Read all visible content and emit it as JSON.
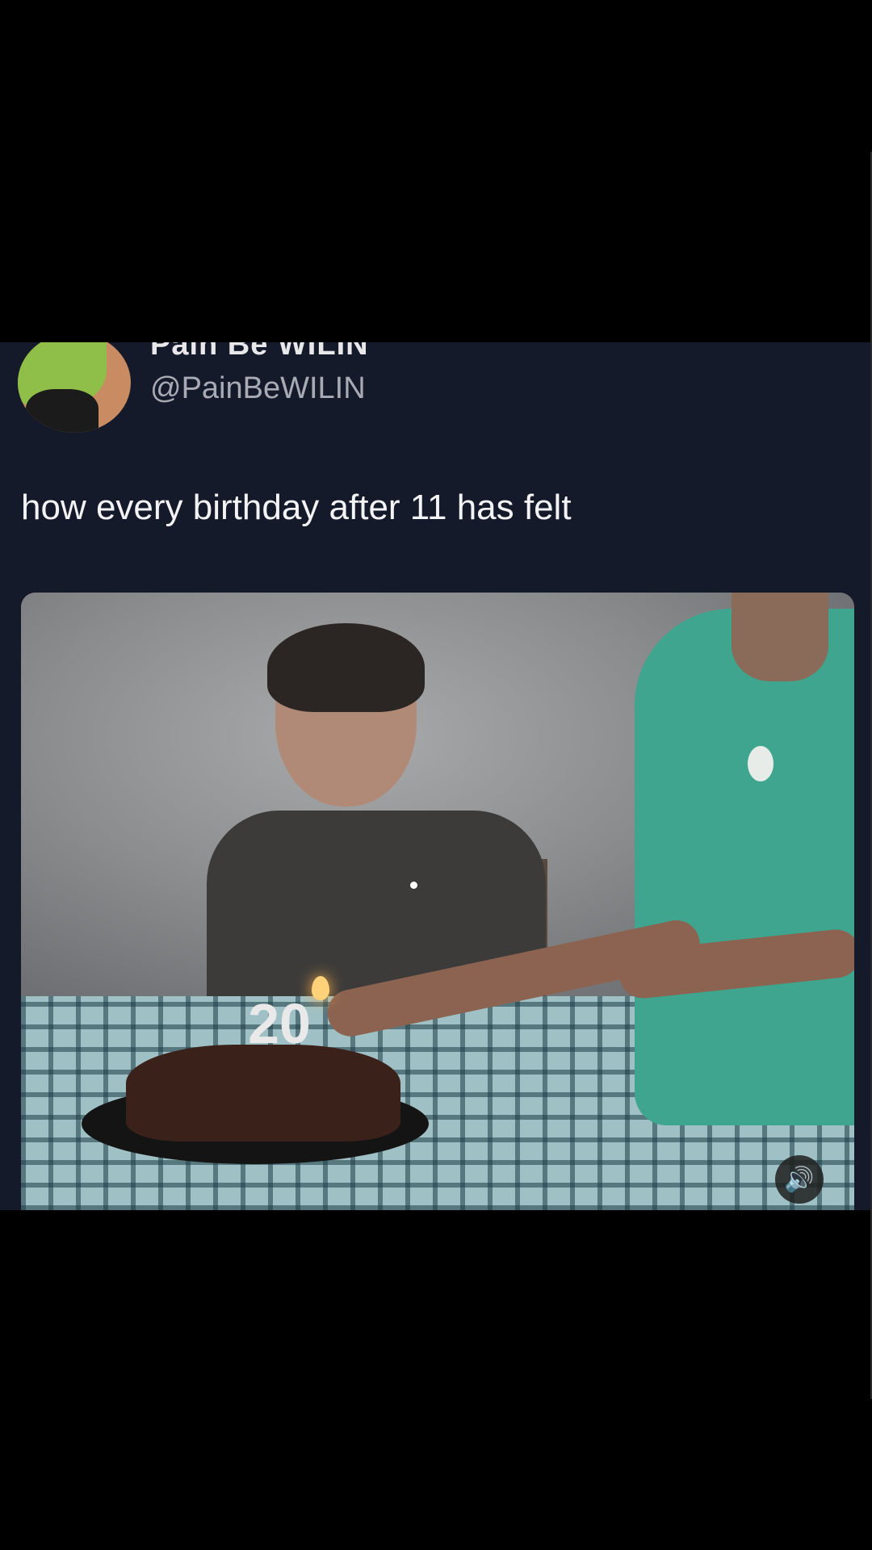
{
  "tweet": {
    "display_name": "Pain Be WILIN",
    "handle": "@PainBeWILIN",
    "text": "how every birthday after 11 has felt"
  },
  "media": {
    "candle_number": "20",
    "volume_icon": "volume-icon"
  },
  "colors": {
    "card_background": "#151a2b",
    "page_background": "#000000",
    "text_primary": "#f3f3f5",
    "text_secondary": "#a8aab4"
  }
}
